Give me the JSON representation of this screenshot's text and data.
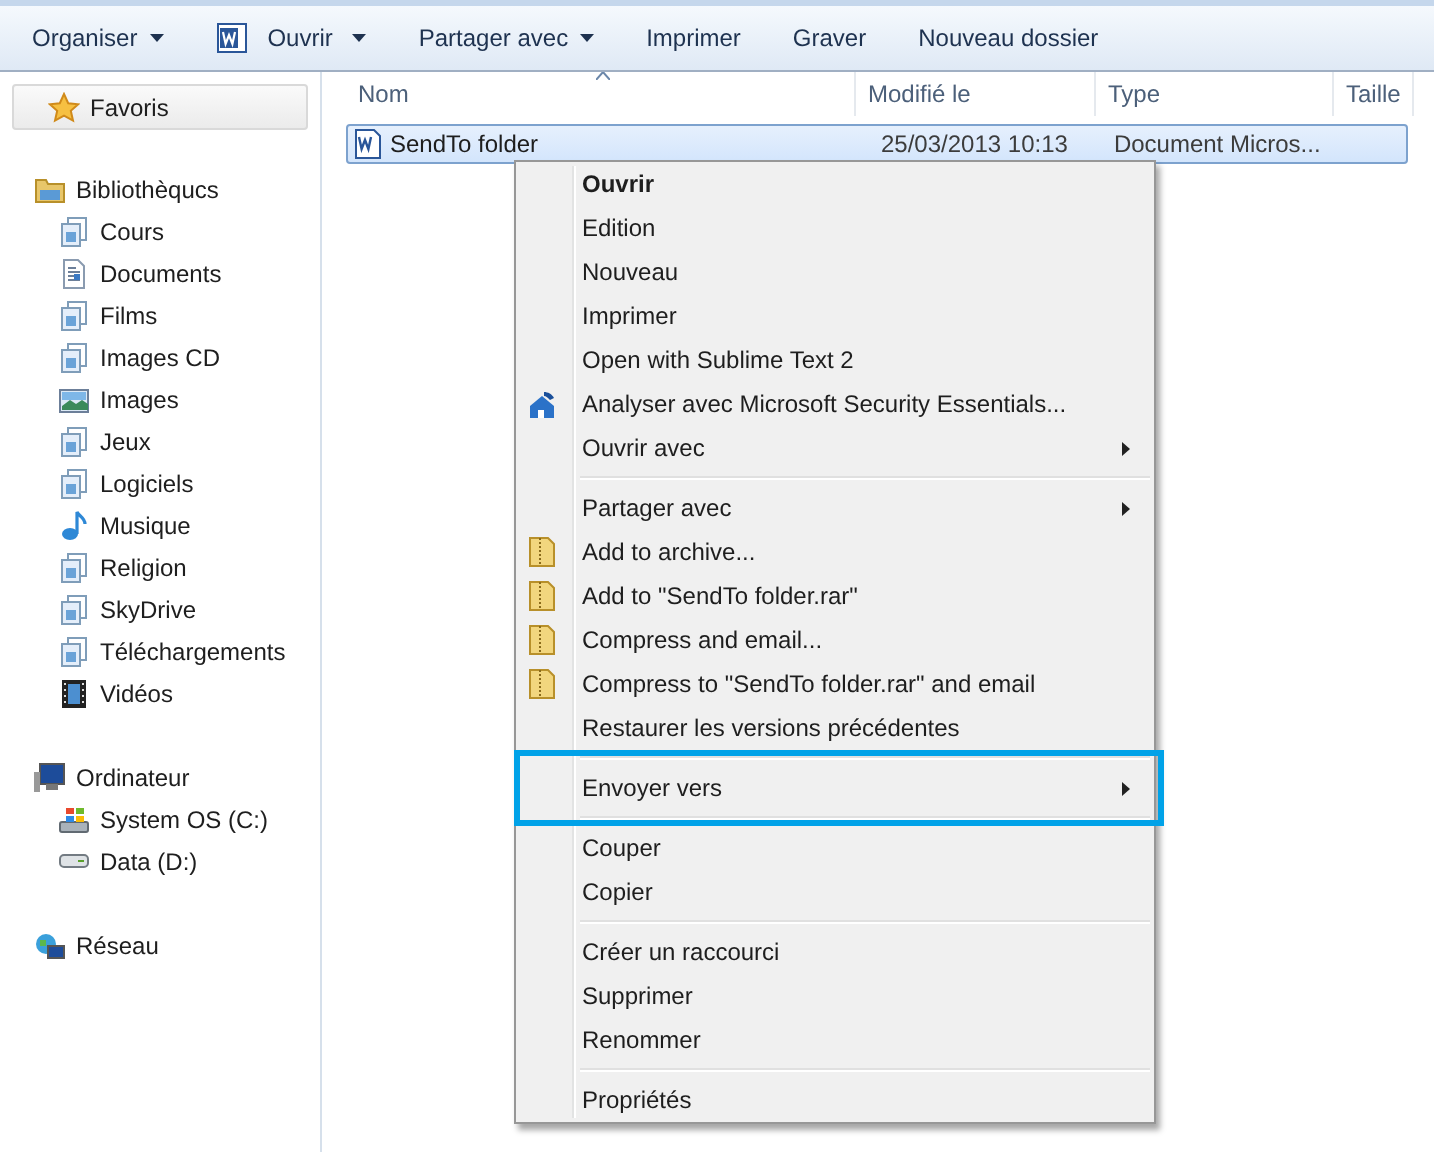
{
  "toolbar": [
    {
      "label": "Organiser",
      "kind": "dropdown"
    },
    {
      "label": "Ouvrir",
      "kind": "app-dropdown"
    },
    {
      "label": "Partager avec",
      "kind": "dropdown"
    },
    {
      "label": "Imprimer",
      "kind": "plain"
    },
    {
      "label": "Graver",
      "kind": "plain"
    },
    {
      "label": "Nouveau dossier",
      "kind": "plain"
    }
  ],
  "sidebar": {
    "groups": [
      {
        "label": "Favoris",
        "kind": "favorites",
        "selected": true
      },
      {
        "label": "Bibliothèqucs",
        "kind": "library",
        "selected": false,
        "children": [
          {
            "label": "Cours",
            "kind": "folder",
            "selected": false
          },
          {
            "label": "Documents",
            "kind": "documents",
            "selected": false
          },
          {
            "label": "Films",
            "kind": "folder",
            "selected": false
          },
          {
            "label": "Images CD",
            "kind": "folder",
            "selected": false
          },
          {
            "label": "Images",
            "kind": "pictures",
            "selected": false
          },
          {
            "label": "Jeux",
            "kind": "folder",
            "selected": false
          },
          {
            "label": "Logiciels",
            "kind": "folder",
            "selected": false
          },
          {
            "label": "Musique",
            "kind": "music",
            "selected": false
          },
          {
            "label": "Religion",
            "kind": "folder",
            "selected": false
          },
          {
            "label": "SkyDrive",
            "kind": "folder",
            "selected": false
          },
          {
            "label": "Téléchargements",
            "kind": "folder",
            "selected": false
          },
          {
            "label": "Vidéos",
            "kind": "videos",
            "selected": false
          }
        ]
      },
      {
        "label": "Ordinateur",
        "kind": "computer",
        "selected": false,
        "children": [
          {
            "label": "System OS (C:)",
            "kind": "system-drive",
            "selected": false
          },
          {
            "label": "Data (D:)",
            "kind": "drive",
            "selected": false
          }
        ]
      },
      {
        "label": "Réseau",
        "kind": "network",
        "selected": false
      }
    ]
  },
  "table": {
    "columns": [
      "Nom",
      "Modifié le",
      "Type",
      "Taille"
    ],
    "rows": [
      {
        "name": "SendTo folder",
        "modified": "25/03/2013 10:13",
        "type": "Document Micros...",
        "selected": true
      }
    ]
  },
  "context_menu": [
    {
      "kind": "plain",
      "label": "Ouvrir",
      "default": true,
      "submenu": false,
      "highlighted": false
    },
    {
      "kind": "plain",
      "label": "Edition",
      "default": false,
      "submenu": false,
      "highlighted": false
    },
    {
      "kind": "plain",
      "label": "Nouveau",
      "default": false,
      "submenu": false,
      "highlighted": false
    },
    {
      "kind": "plain",
      "label": "Imprimer",
      "default": false,
      "submenu": false,
      "highlighted": false
    },
    {
      "kind": "plain",
      "label": "Open with Sublime Text 2",
      "default": false,
      "submenu": false,
      "highlighted": false
    },
    {
      "kind": "shield",
      "label": "Analyser avec Microsoft Security Essentials...",
      "default": false,
      "submenu": false,
      "highlighted": false
    },
    {
      "kind": "plain",
      "label": "Ouvrir avec",
      "default": false,
      "submenu": true,
      "highlighted": false
    },
    {
      "kind": "separator"
    },
    {
      "kind": "plain",
      "label": "Partager avec",
      "default": false,
      "submenu": true,
      "highlighted": false
    },
    {
      "kind": "archive",
      "label": "Add to archive...",
      "default": false,
      "submenu": false,
      "highlighted": false
    },
    {
      "kind": "archive",
      "label": "Add to \"SendTo folder.rar\"",
      "default": false,
      "submenu": false,
      "highlighted": false
    },
    {
      "kind": "archive",
      "label": "Compress and email...",
      "default": false,
      "submenu": false,
      "highlighted": false
    },
    {
      "kind": "archive",
      "label": "Compress to \"SendTo folder.rar\" and email",
      "default": false,
      "submenu": false,
      "highlighted": false
    },
    {
      "kind": "plain",
      "label": "Restaurer les versions précédentes",
      "default": false,
      "submenu": false,
      "highlighted": false
    },
    {
      "kind": "separator"
    },
    {
      "kind": "plain",
      "label": "Envoyer vers",
      "default": false,
      "submenu": true,
      "highlighted": true
    },
    {
      "kind": "separator"
    },
    {
      "kind": "plain",
      "label": "Couper",
      "default": false,
      "submenu": false,
      "highlighted": false
    },
    {
      "kind": "plain",
      "label": "Copier",
      "default": false,
      "submenu": false,
      "highlighted": false
    },
    {
      "kind": "separator"
    },
    {
      "kind": "plain",
      "label": "Créer un raccourci",
      "default": false,
      "submenu": false,
      "highlighted": false
    },
    {
      "kind": "plain",
      "label": "Supprimer",
      "default": false,
      "submenu": false,
      "highlighted": false
    },
    {
      "kind": "plain",
      "label": "Renommer",
      "default": false,
      "submenu": false,
      "highlighted": false
    },
    {
      "kind": "separator"
    },
    {
      "kind": "plain",
      "label": "Propriétés",
      "default": false,
      "submenu": false,
      "highlighted": false
    }
  ]
}
